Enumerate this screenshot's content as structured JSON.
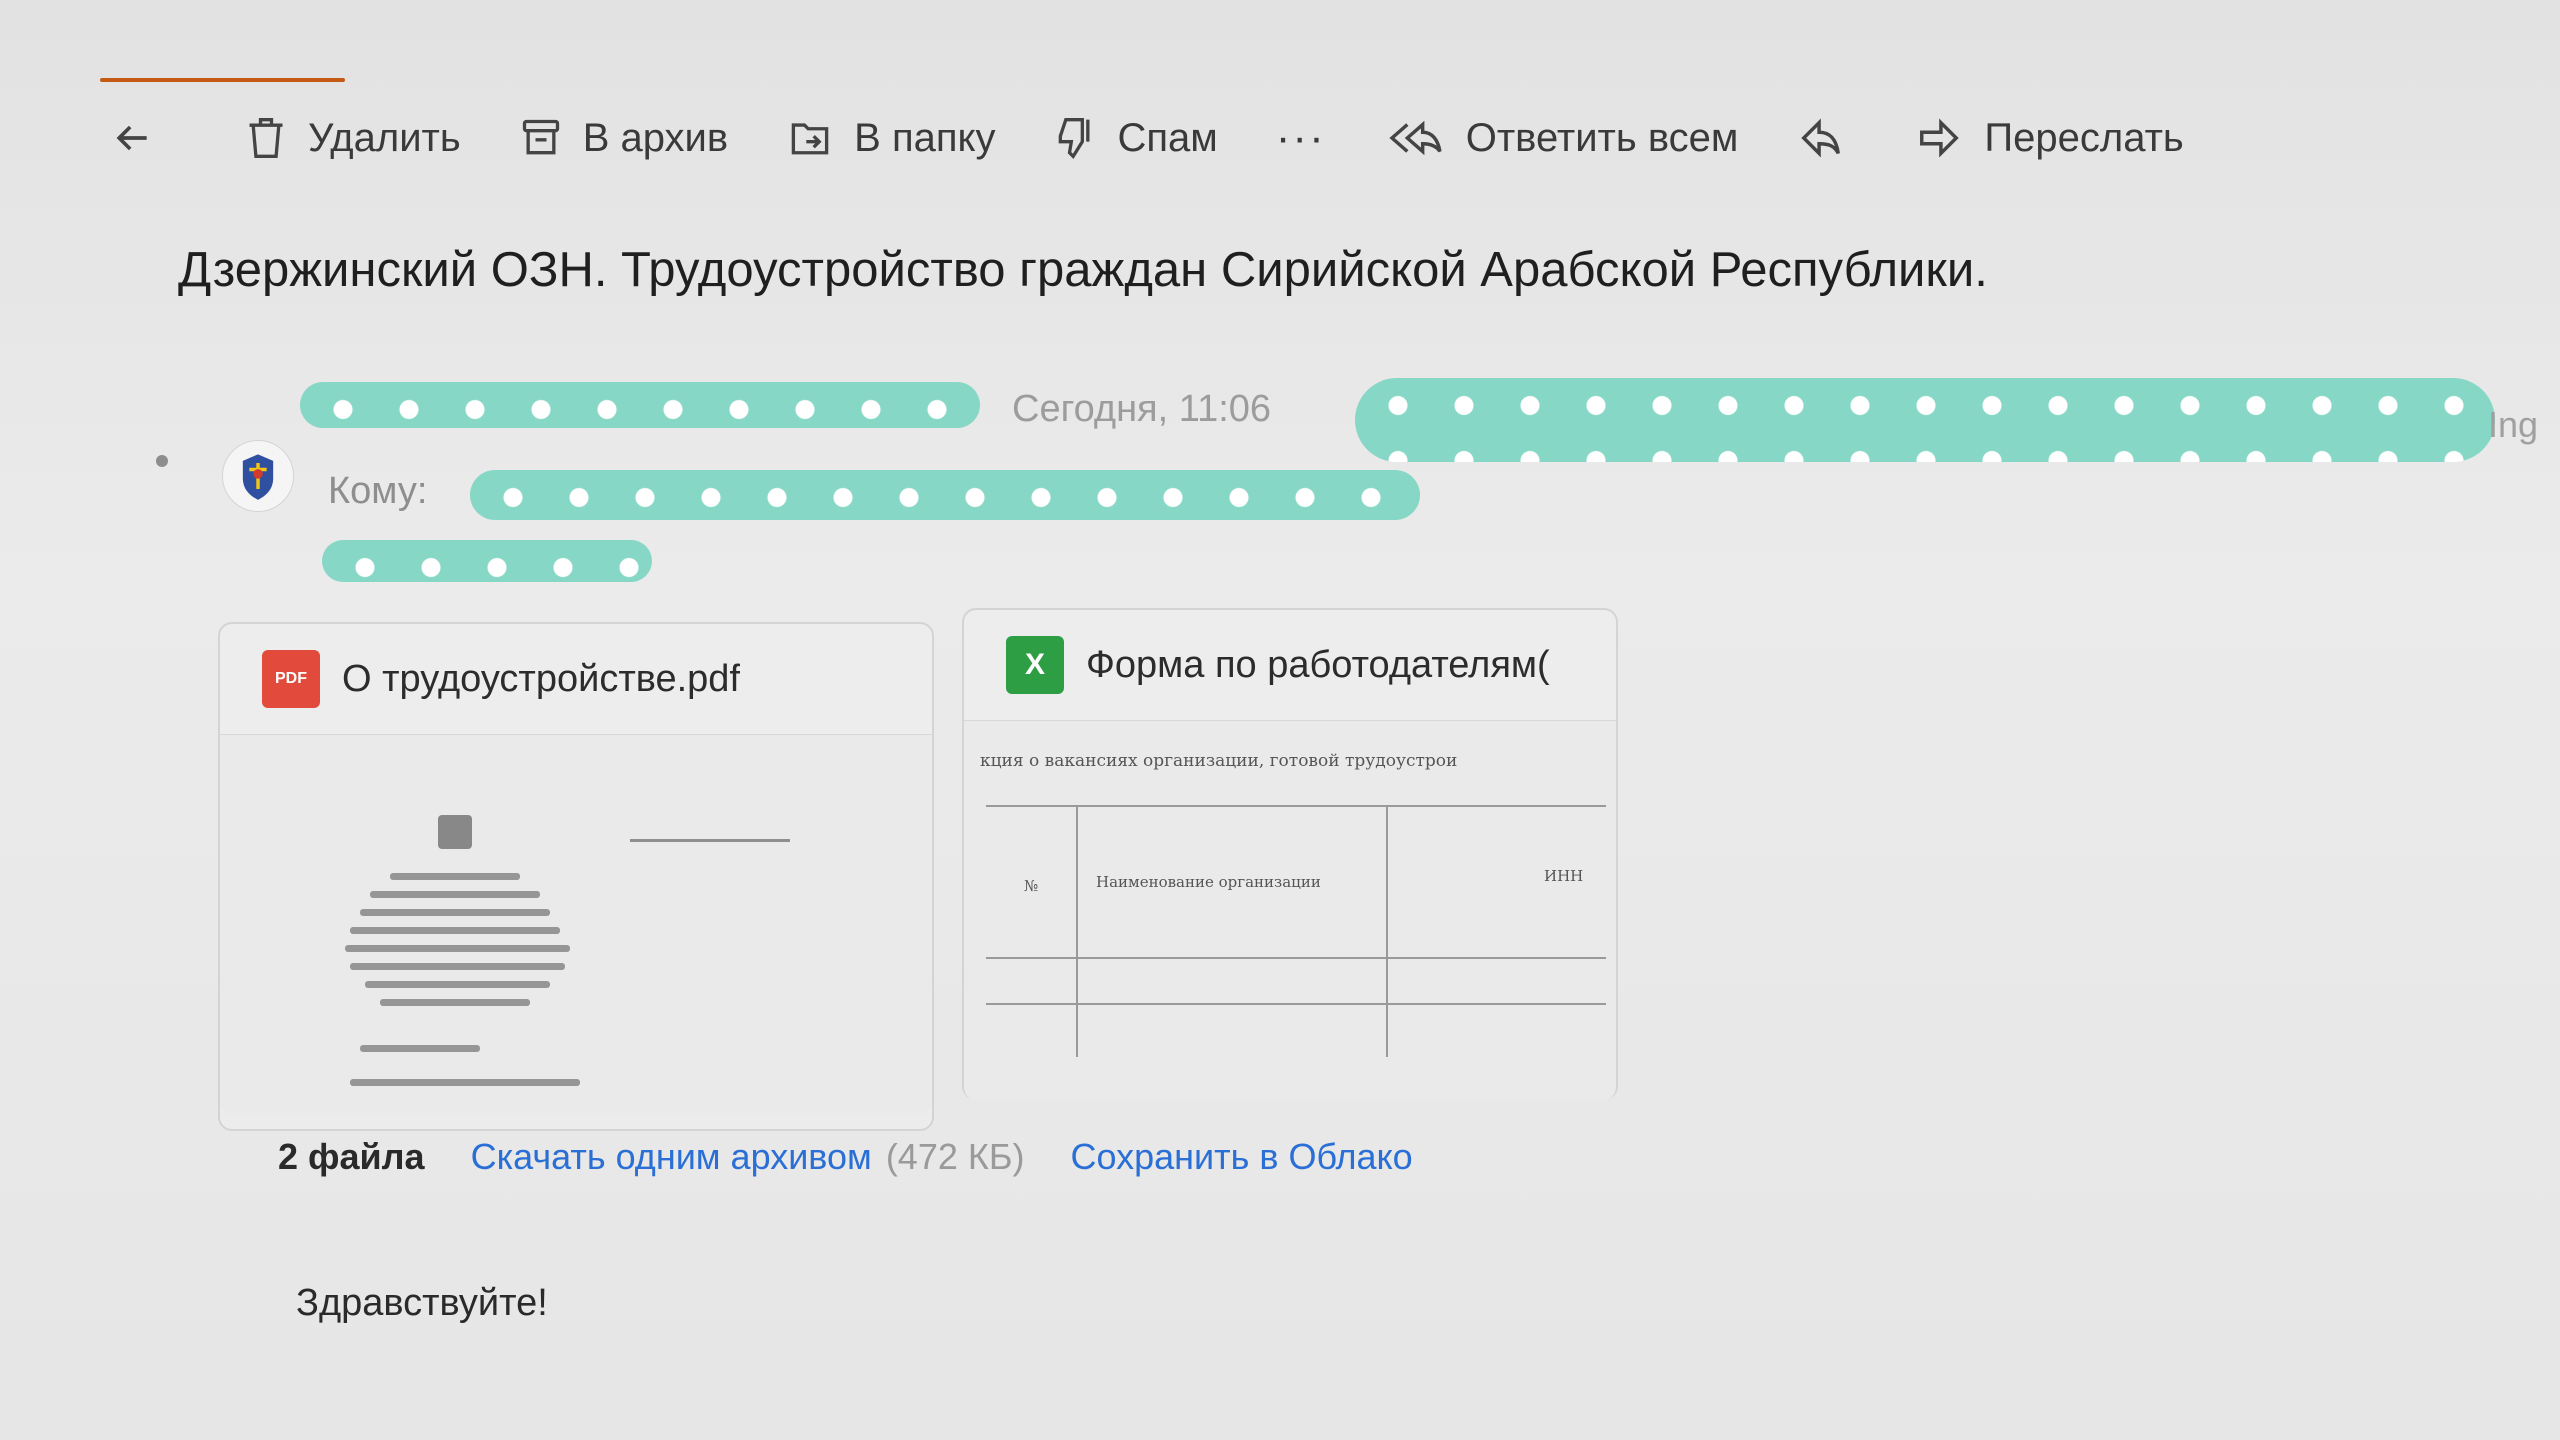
{
  "toolbar": {
    "delete_label": "Удалить",
    "archive_label": "В архив",
    "folder_label": "В папку",
    "spam_label": "Спам",
    "more_label": "···",
    "reply_all_label": "Ответить всем",
    "forward_label": "Переслать"
  },
  "letter": {
    "subject": "Дзержинский ОЗН. Трудоустройство граждан Сирийской Арабской Республики.",
    "date": "Сегодня, 11:06",
    "to_label": "Кому:",
    "edge_text": "Ing"
  },
  "attachments": {
    "pdf": {
      "name": "О трудоустройстве.pdf",
      "type_badge": "PDF"
    },
    "xls": {
      "name": "Форма по работодателям(",
      "type_badge": "X",
      "preview_caption": "кция о вакансиях организации, готовой трудоустрои",
      "preview_col_num": "№",
      "preview_col_name": "Наименование организации",
      "preview_col_inn": "ИНН"
    },
    "count_label": "2 файла",
    "download_label": "Скачать одним архивом",
    "size_label": "(472 КБ)",
    "save_cloud_label": "Сохранить в Облако"
  },
  "body": {
    "greeting": "Здравствуйте!"
  },
  "colors": {
    "accent": "#c35a16",
    "link": "#2a6fd6",
    "redaction": "#86d7c5",
    "pdf_badge": "#e24a3c",
    "xls_badge": "#2e9e44"
  }
}
